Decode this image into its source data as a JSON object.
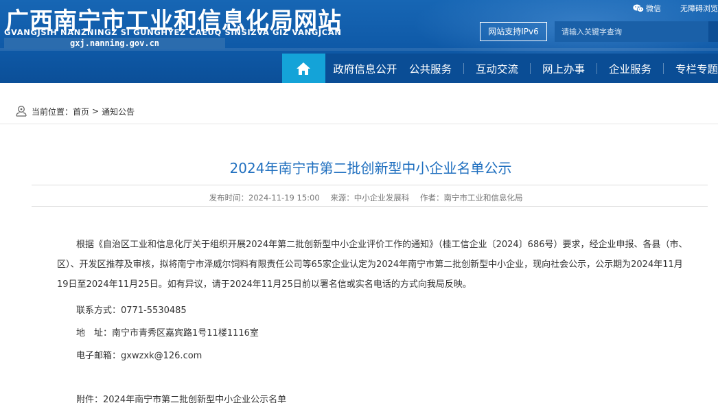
{
  "header": {
    "title": "广西南宁市工业和信息化局网站",
    "subtitle": "GVANGJSIH NANZNINGZ SI GUNGHYEZ CAEUQ SINSIZVA GIZ VANGJCAN",
    "domain": "gxj.nanning.gov.cn",
    "top_links": {
      "wechat": "微信",
      "accessibility": "无障碍浏览"
    },
    "ipv6": "网站支持IPv6",
    "search": {
      "placeholder": "请输入关键字查询"
    }
  },
  "nav": {
    "items": [
      "政府信息公开",
      "公共服务",
      "互动交流",
      "网上办事",
      "企业服务",
      "专栏专题"
    ]
  },
  "breadcrumb": {
    "prefix": "当前位置：",
    "home": "首页",
    "sep": ">",
    "current": "通知公告"
  },
  "article": {
    "title": "2024年南宁市第二批创新型中小企业名单公示",
    "meta": {
      "publish_time": "发布时间：2024-11-19 15:00",
      "source": "来源：中小企业发展科",
      "author": "作者：南宁市工业和信息化局"
    },
    "body": "根据《自治区工业和信息化厅关于组织开展2024年第二批创新型中小企业评价工作的通知》（桂工信企业〔2024〕686号）要求，经企业申报、各县（市、区）、开发区推荐及审核，拟将南宁市泽威尔饲料有限责任公司等65家企业认定为2024年南宁市第二批创新型中小企业，现向社会公示，公示期为2024年11月19日至2024年11月25日。如有异议，请于2024年11月25日前以署名信或实名电话的方式向我局反映。",
    "contact": "联系方式：0771-5530485",
    "address": "地　址：南宁市青秀区嘉宾路1号11楼1116室",
    "email": "电子邮箱：gxwzxk@126.com",
    "attachment": "附件：2024年南宁市第二批创新型中小企业公示名单"
  },
  "colors": {
    "header_blue": "#0f5aa8",
    "nav_blue": "#0a4d95",
    "home_button": "#14a3d8",
    "title_blue": "#1f6fbf"
  },
  "icons": [
    "wechat-icon",
    "home-icon",
    "location-icon"
  ]
}
